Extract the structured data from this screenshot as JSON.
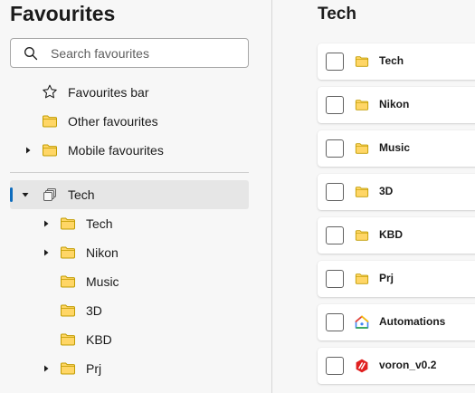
{
  "sidebar": {
    "title": "Favourites",
    "search": {
      "placeholder": "Search favourites",
      "value": ""
    },
    "top_items": [
      {
        "label": "Favourites bar",
        "icon": "star-icon"
      },
      {
        "label": "Other favourites",
        "icon": "folder-icon"
      },
      {
        "label": "Mobile favourites",
        "icon": "folder-icon"
      }
    ],
    "tree": {
      "root": {
        "label": "Tech",
        "icon": "collections-icon",
        "expanded": true
      },
      "children": [
        {
          "label": "Tech",
          "icon": "folder-icon",
          "has_children": true
        },
        {
          "label": "Nikon",
          "icon": "folder-icon",
          "has_children": true
        },
        {
          "label": "Music",
          "icon": "folder-icon",
          "has_children": false
        },
        {
          "label": "3D",
          "icon": "folder-icon",
          "has_children": false
        },
        {
          "label": "KBD",
          "icon": "folder-icon",
          "has_children": false
        },
        {
          "label": "Prj",
          "icon": "folder-icon",
          "has_children": true
        }
      ]
    }
  },
  "main": {
    "title": "Tech",
    "items": [
      {
        "label": "Tech",
        "icon": "folder-icon"
      },
      {
        "label": "Nikon",
        "icon": "folder-icon"
      },
      {
        "label": "Music",
        "icon": "folder-icon"
      },
      {
        "label": "3D",
        "icon": "folder-icon"
      },
      {
        "label": "KBD",
        "icon": "folder-icon"
      },
      {
        "label": "Prj",
        "icon": "folder-icon"
      },
      {
        "label": "Automations",
        "icon": "google-home-icon"
      },
      {
        "label": "voron_v0.2",
        "icon": "voron-icon"
      }
    ]
  },
  "colors": {
    "accent": "#0f6cbd",
    "folder_fill": "#ffd666",
    "folder_stroke": "#c19c00",
    "voron_red": "#e02020"
  }
}
